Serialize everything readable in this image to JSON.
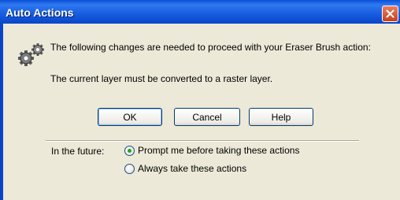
{
  "window": {
    "title": "Auto Actions",
    "close_symbol": "×"
  },
  "message": {
    "icon": "gears-icon",
    "line1": "The following changes are needed to proceed with your Eraser Brush action:",
    "line2": "The current layer must be converted to a raster layer."
  },
  "buttons": {
    "ok": "OK",
    "cancel": "Cancel",
    "help": "Help"
  },
  "future": {
    "label": "In the future:",
    "options": [
      {
        "label": "Prompt me before taking these actions",
        "selected": true
      },
      {
        "label": "Always take these actions",
        "selected": false
      }
    ]
  },
  "colors": {
    "titlebar": "#0a4fd6",
    "close_button": "#d6532e",
    "client_background": "#ece9d8",
    "radio_selected": "#21a121"
  }
}
